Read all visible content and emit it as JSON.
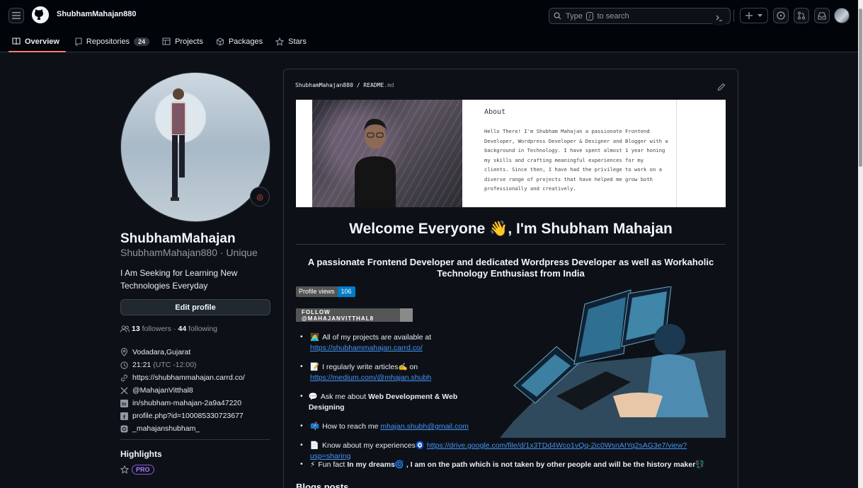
{
  "header": {
    "context_user": "ShubhamMahajan880",
    "search": {
      "prefix": "Type",
      "key": "/",
      "suffix": "to search"
    }
  },
  "tabs": [
    {
      "label": "Overview",
      "icon": "book-icon"
    },
    {
      "label": "Repositories",
      "icon": "repo-icon",
      "count": "24"
    },
    {
      "label": "Projects",
      "icon": "table-icon"
    },
    {
      "label": "Packages",
      "icon": "package-icon"
    },
    {
      "label": "Stars",
      "icon": "star-icon"
    }
  ],
  "profile": {
    "name": "ShubhamMahajan",
    "login": "ShubhamMahajan880 · Unique",
    "bio": "I Am Seeking for Learning New Technologies Everyday",
    "edit_label": "Edit profile",
    "followers_count": "13",
    "followers_label": "followers",
    "sep": "·",
    "following_count": "44",
    "following_label": "following",
    "location": "Vodadara,Gujarat",
    "time": "21:21",
    "timezone": "(UTC -12:00)",
    "website": "https://shubhammahajan.carrd.co/",
    "x_handle": "@MahajanVitthal8",
    "linkedin": "in/shubham-mahajan-2a9a47220",
    "facebook": "profile.php?id=100085330723677",
    "instagram": "_mahajanshubham_",
    "highlights_title": "Highlights",
    "pro_label": "PRO"
  },
  "readme": {
    "path_owner": "ShubhamMahajan880",
    "path_sep": "/",
    "path_file": "README",
    "path_ext": ".md",
    "about_title": "About",
    "about_text": "Hello There! I'm Shubham Mahajan a passionate Frontend Developer, Wordpress Developer & Designer and Blogger with a background in Technology. I have spent almost 1 year honing my skills and crafting meaningful experiences for my clients. Since then, I have had the privilege to work on a diverse range of projects that have helped me grow both professionally and creatively.",
    "heading_welcome": "Welcome Everyone 👋, I'm Shubham Mahajan",
    "heading_tagline": "A passionate Frontend Developer and dedicated Wordpress Developer as well as Workaholic Technology Enthusiast from India",
    "views_label": "Profile views",
    "views_count": "106",
    "follow_badge": "FOLLOW @MAHAJANVITTHAL8",
    "bullets": [
      {
        "emoji": "🧑‍💻",
        "text": "All of my projects are available at",
        "link": "https://shubhammahajan.carrd.co/"
      },
      {
        "emoji": "📝",
        "text": "I regularly write articles✍️ on",
        "link": "https://medium.com/@mhajan.shubh"
      },
      {
        "emoji": "💬",
        "text": "Ask me about",
        "bold": "Web Development & Web Designing"
      },
      {
        "emoji": "📫",
        "text": "How to reach me",
        "link": "mhajan.shubh@gmail.com"
      },
      {
        "emoji": "📄",
        "text": "Know about my experiences🧿",
        "link": "https://drive.google.com/file/d/1x3TDd4Wco1vQq-2ic0WsnAIYq2sAG3e7/view?usp=sharing"
      },
      {
        "emoji": "⚡",
        "text": "Fun fact",
        "bold": "In my dreams🌀 , I am on the path which is not taken by other people and will be the history maker💱"
      }
    ],
    "blogs_heading": "Blogs posts"
  }
}
